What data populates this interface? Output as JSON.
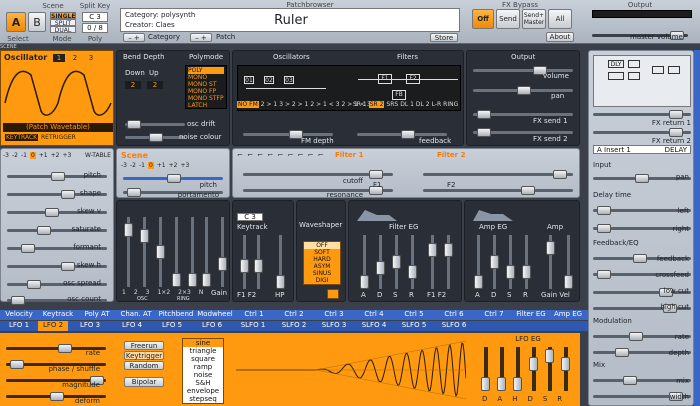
{
  "top": {
    "scene_title": "Scene",
    "scene_a": "A",
    "scene_b": "B",
    "scene_mode_options": [
      "SINGLE",
      "SPLIT",
      "DUAL"
    ],
    "split_key_title": "Split Key",
    "split_key_value": "C 3",
    "poly_value": "0 / 8",
    "select_label": "Select",
    "mode_label": "Mode",
    "poly_label": "Poly",
    "patchbrowser_title": "Patchbrowser",
    "category_text": "Category: polysynth",
    "creator_text": "Creator: Claes",
    "patch_name": "Ruler",
    "category_label": "Category",
    "patch_label": "Patch",
    "store_label": "Store",
    "fx_bypass_title": "FX Bypass",
    "fx_off": "Off",
    "fx_send": "Send",
    "fx_send_master": "Send+ Master",
    "fx_all": "All",
    "about_label": "About",
    "output_title": "Output",
    "master_volume_label": "master volume",
    "scene_strip": "SCENE"
  },
  "oscillator": {
    "title": "Oscillator",
    "numbers": [
      "1",
      "2",
      "3"
    ],
    "type_label": "(Patch Wavetable)",
    "keytrack_label": "KEYTRACK",
    "retrigger_label": "RETRIGGER",
    "octave_row": [
      "-3",
      "-2",
      "-1",
      "0",
      "+1",
      "+2",
      "+3"
    ],
    "wtable_label": "W-TABLE",
    "sliders": [
      "pitch",
      "shape",
      "skew v",
      "saturate",
      "formant",
      "skew h",
      "osc spread",
      "osc count"
    ]
  },
  "bend": {
    "title": "Bend Depth",
    "down_label": "Down",
    "up_label": "Up",
    "down_value": "2",
    "up_value": "2"
  },
  "polymode": {
    "title": "Polymode",
    "options": [
      "POLY",
      "MONO",
      "MONO ST",
      "MONO FP",
      "MONO STFP",
      "LATCH"
    ],
    "osc_drift": "osc drift",
    "noise_colour": "noise colour"
  },
  "oscillators_panel": {
    "title": "Oscillators",
    "boxes": [
      "01",
      "02",
      "03"
    ],
    "routing_labels": [
      "NO FM",
      "2 > 1",
      "3 > 2 > 1",
      "2 > 1 < 3",
      "2 > 1 < 3"
    ],
    "fm_depth": "FM depth"
  },
  "filters_panel": {
    "title": "Filters",
    "nodes": [
      "F1",
      "F2",
      "FB"
    ],
    "routing_labels": [
      "SR 1",
      "SR 2",
      "SRS",
      "DL 1",
      "DL 2",
      "L-R",
      "RING"
    ],
    "feedback": "feedback"
  },
  "output_panel": {
    "title": "Output",
    "volume": "volume",
    "pan": "pan",
    "fx_send_1": "FX send 1",
    "fx_send_2": "FX send 2"
  },
  "scene_panel": {
    "title": "Scene",
    "octave_row": [
      "-3",
      "-2",
      "-1",
      "0",
      "+1",
      "+2",
      "+3"
    ],
    "pitch": "pitch",
    "portamento": "portamento"
  },
  "filter_header": {
    "filter1_label": "Filter 1",
    "filter2_label": "Filter 2",
    "cutoff": "cutoff",
    "resonance": "resonance",
    "f1": "F1",
    "f2": "F2"
  },
  "mixer": {
    "labels": [
      "1",
      "2",
      "3",
      "1×2",
      "2×3",
      "N"
    ],
    "osc_label": "OSC",
    "ring_label": "RING",
    "gain_label": "Gain"
  },
  "keytrack": {
    "title": "Keytrack",
    "value": "C 3",
    "f1f2": "F1 F2",
    "hp": "HP"
  },
  "waveshaper": {
    "title": "Waveshaper",
    "options": [
      "OFF",
      "SOFT",
      "HARD",
      "ASYM",
      "SINUS",
      "DIGI"
    ]
  },
  "filter_eg": {
    "title": "Filter EG",
    "labels": [
      "A",
      "D",
      "S",
      "R",
      "F1 F2"
    ]
  },
  "amp_eg": {
    "title": "Amp EG",
    "amp_title": "Amp",
    "labels": [
      "A",
      "D",
      "S",
      "R",
      "Gain Vel"
    ]
  },
  "fx": {
    "fx_return_1": "FX return 1",
    "fx_return_2": "FX return 2",
    "insert_label": "A Insert 1",
    "insert_value": "DELAY",
    "input_title": "Input",
    "pan": "pan",
    "delay_title": "Delay time",
    "left": "left",
    "right": "right",
    "feedback_title": "Feedback/EQ",
    "feedback": "feedback",
    "crossfeed": "crossfeed",
    "low_cut": "low cut",
    "high_cut": "high cut",
    "modulation_title": "Modulation",
    "rate": "rate",
    "depth": "depth",
    "mix_title": "Mix",
    "mix": "mix",
    "width": "width",
    "fx_strip": "FX",
    "routing_boxes": [
      "DLY",
      "",
      "",
      "",
      ""
    ]
  },
  "mod_sources_row1": [
    "Velocity",
    "Keytrack",
    "Poly AT",
    "Chan. AT",
    "Pitchbend",
    "Modwheel",
    "Ctrl 1",
    "Ctrl 2",
    "Ctrl 3",
    "Ctrl 4",
    "Ctrl 5",
    "Ctrl 6",
    "Ctrl 7",
    "Filter EG",
    "Amp EG"
  ],
  "mod_sources_row2": [
    "LFO 1",
    "LFO 2",
    "LFO 3",
    "LFO 4",
    "LFO 5",
    "LFO 6",
    "SLFO 1",
    "SLFO 2",
    "SLFO 3",
    "SLFO 4",
    "SLFO 5",
    "SLFO 6"
  ],
  "lfo": {
    "rate": "rate",
    "phase_shuffle": "phase / shuffle",
    "magnitude": "magnitude",
    "deform": "deform",
    "freerun": "Freerun",
    "keytrigger": "Keytrigger",
    "random": "Random",
    "bipolar": "Bipolar",
    "shapes": [
      "sine",
      "triangle",
      "square",
      "ramp",
      "noise",
      "S&H",
      "envelope",
      "stepseq"
    ],
    "eg_title": "LFO EG",
    "eg_labels": [
      "D",
      "A",
      "H",
      "D",
      "S",
      "R"
    ],
    "mod_strip": "MODULATION"
  }
}
